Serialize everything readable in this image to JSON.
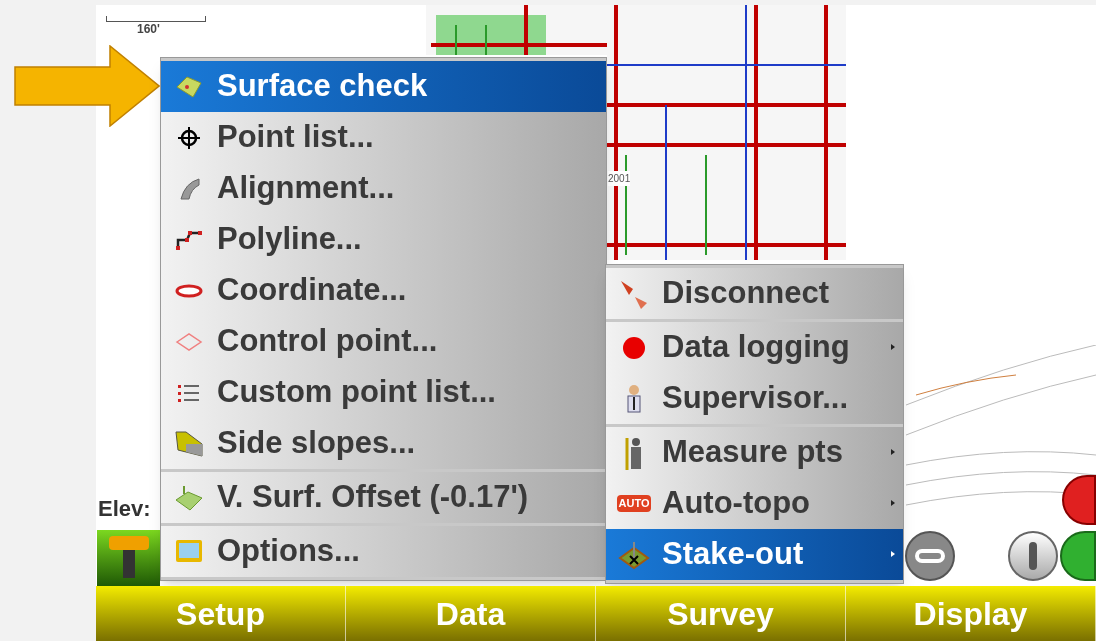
{
  "scale_bar": {
    "label": "160'"
  },
  "map": {
    "labels": [
      "2001"
    ]
  },
  "elevation_label": "Elev:",
  "data_menu": {
    "groups": [
      [
        {
          "label": "Surface check",
          "selected": true
        },
        {
          "label": "Point list...",
          "selected": false
        },
        {
          "label": "Alignment...",
          "selected": false
        },
        {
          "label": "Polyline...",
          "selected": false
        },
        {
          "label": "Coordinate...",
          "selected": false
        },
        {
          "label": "Control point...",
          "selected": false
        },
        {
          "label": "Custom point list...",
          "selected": false
        },
        {
          "label": "Side slopes...",
          "selected": false
        }
      ],
      [
        {
          "label": "V. Surf. Offset (-0.17')",
          "selected": false
        }
      ],
      [
        {
          "label": "Options...",
          "selected": false
        }
      ]
    ]
  },
  "survey_menu": {
    "groups": [
      [
        {
          "label": "Disconnect",
          "selected": false,
          "has_submenu": false
        }
      ],
      [
        {
          "label": "Data logging",
          "selected": false,
          "has_submenu": true
        },
        {
          "label": "Supervisor...",
          "selected": false,
          "has_submenu": false
        }
      ],
      [
        {
          "label": "Measure pts",
          "selected": false,
          "has_submenu": true
        },
        {
          "label": "Auto-topo",
          "selected": false,
          "has_submenu": true
        },
        {
          "label": "Stake-out",
          "selected": true,
          "has_submenu": true
        }
      ]
    ]
  },
  "auto_badge": "AUTO",
  "bottom_tabs": [
    {
      "label": "Setup"
    },
    {
      "label": "Data"
    },
    {
      "label": "Survey"
    },
    {
      "label": "Display"
    }
  ]
}
